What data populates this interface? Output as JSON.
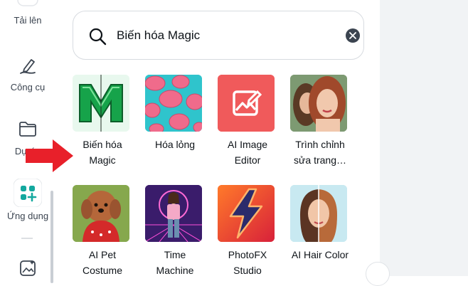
{
  "rail": {
    "items": [
      {
        "label": "Tải lên",
        "icon": "upload-icon"
      },
      {
        "label": "Công cụ",
        "icon": "draw-pen-icon"
      },
      {
        "label": "Dự án",
        "icon": "folder-icon"
      },
      {
        "label": "Ứng dụng",
        "icon": "apps-grid-icon"
      },
      {
        "label": "",
        "icon": "magic-media-icon"
      }
    ]
  },
  "search": {
    "value": "Biến hóa Magic",
    "icon": "search-icon",
    "clear_icon": "clear-icon"
  },
  "apps": [
    {
      "name": "Biến hóa Magic",
      "thumb": "magic-morph-thumb"
    },
    {
      "name": "Hóa lỏng",
      "thumb": "liquify-thumb"
    },
    {
      "name": "AI Image Editor",
      "thumb": "ai-image-editor-thumb"
    },
    {
      "name": "Trình chỉnh sửa trang…",
      "thumb": "portrait-editor-thumb"
    },
    {
      "name": "AI Pet Costume",
      "thumb": "pet-costume-thumb"
    },
    {
      "name": "Time Machine",
      "thumb": "time-machine-thumb"
    },
    {
      "name": "PhotoFX Studio",
      "thumb": "photofx-thumb"
    },
    {
      "name": "AI Hair Color",
      "thumb": "hair-color-thumb"
    }
  ],
  "colors": {
    "accent_teal": "#13a89e",
    "arrow_red": "#e8202a",
    "ai_editor_bg": "#f25c5c"
  }
}
